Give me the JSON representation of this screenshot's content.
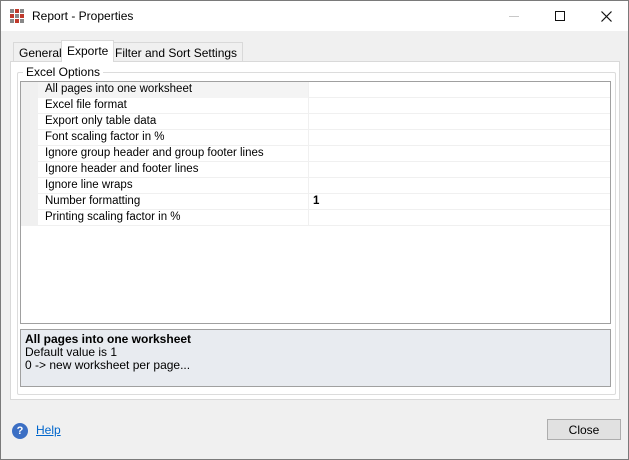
{
  "window": {
    "title": "Report - Properties",
    "icon": "grid-app-icon",
    "icon_colors": [
      "#888888",
      "#c0392b",
      "#888888",
      "#c0392b",
      "#888888",
      "#c0392b",
      "#888888",
      "#c0392b",
      "#888888"
    ]
  },
  "tabs": [
    {
      "label": "General",
      "active": false
    },
    {
      "label": "Exporte",
      "active": true
    },
    {
      "label": "Filter and Sort Settings",
      "active": false
    }
  ],
  "group": {
    "label": "Excel Options"
  },
  "properties": [
    {
      "name": "All pages into one worksheet",
      "value": ""
    },
    {
      "name": "Excel file format",
      "value": ""
    },
    {
      "name": "Export only table data",
      "value": ""
    },
    {
      "name": "Font scaling factor in %",
      "value": ""
    },
    {
      "name": "Ignore group header and group footer lines",
      "value": ""
    },
    {
      "name": "Ignore header and footer lines",
      "value": ""
    },
    {
      "name": "Ignore line wraps",
      "value": ""
    },
    {
      "name": "Number formatting",
      "value": "1"
    },
    {
      "name": "Printing scaling factor in %",
      "value": ""
    }
  ],
  "description": {
    "title": "All pages into one worksheet",
    "line1": "Default value is 1",
    "line2": "0 -> new worksheet per page..."
  },
  "footer": {
    "help_label": "Help",
    "close_label": "Close"
  },
  "colors": {
    "link": "#0066cc",
    "help_icon": "#3c6fc4",
    "description_bg": "#e8ebf0"
  }
}
